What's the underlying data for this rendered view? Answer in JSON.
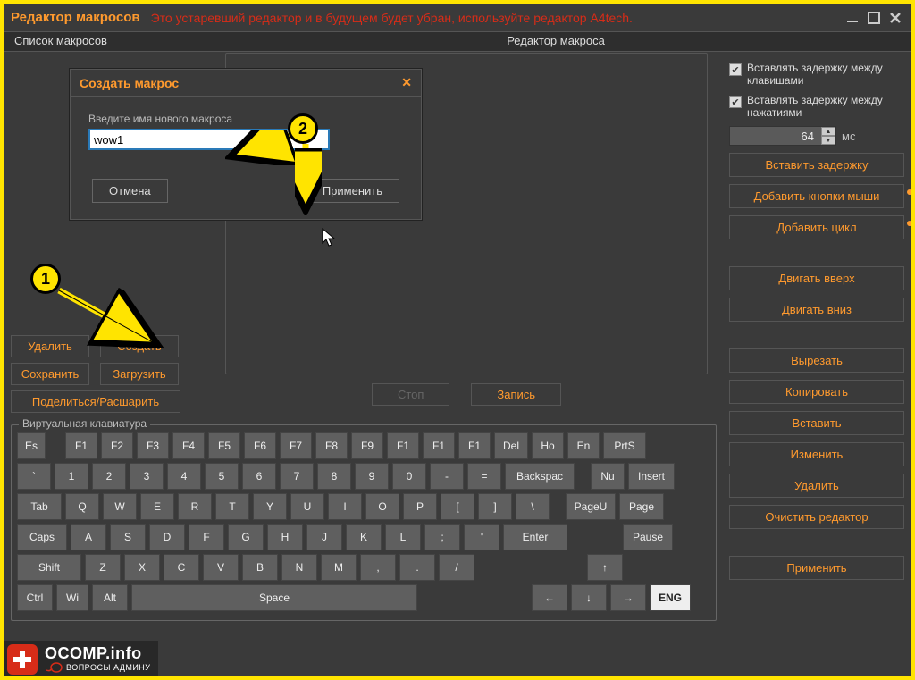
{
  "titlebar": {
    "title": "Редактор макросов",
    "warning": "Это устаревший редактор и в будущем будет убран, используйте редактор A4tech."
  },
  "tabs": {
    "list": "Список макросов",
    "editor": "Редактор макроса"
  },
  "left_buttons": {
    "delete": "Удалить",
    "create": "Создать",
    "save": "Сохранить",
    "load": "Загрузить",
    "share": "Поделиться/Расшарить"
  },
  "record": {
    "stop": "Стоп",
    "record": "Запись"
  },
  "right": {
    "chk1": "Вставлять задержку между клавишами",
    "chk2": "Вставлять задержку между нажатиями",
    "delay_value": "64",
    "delay_unit": "мс",
    "insert_delay": "Вставить задержку",
    "add_mouse": "Добавить кнопки мыши",
    "add_loop": "Добавить цикл",
    "move_up": "Двигать вверх",
    "move_down": "Двигать вниз",
    "cut": "Вырезать",
    "copy": "Копировать",
    "paste": "Вставить",
    "edit": "Изменить",
    "delete": "Удалить",
    "clear": "Очистить редактор",
    "apply": "Применить"
  },
  "vkb": {
    "legend": "Виртуальная клавиатура",
    "row1": [
      "Es",
      "F1",
      "F2",
      "F3",
      "F4",
      "F5",
      "F6",
      "F7",
      "F8",
      "F9",
      "F1",
      "F1",
      "F1",
      "Del",
      "Ho",
      "En",
      "PrtS"
    ],
    "row2": [
      "`",
      "1",
      "2",
      "3",
      "4",
      "5",
      "6",
      "7",
      "8",
      "9",
      "0",
      "-",
      "=",
      "Backspac",
      "Nu",
      "Insert"
    ],
    "row3": [
      "Tab",
      "Q",
      "W",
      "E",
      "R",
      "T",
      "Y",
      "U",
      "I",
      "O",
      "P",
      "[",
      "]",
      "\\",
      "PageU",
      "Page"
    ],
    "row4": [
      "Caps",
      "A",
      "S",
      "D",
      "F",
      "G",
      "H",
      "J",
      "K",
      "L",
      ";",
      "'",
      "Enter",
      "Pause"
    ],
    "row5": [
      "Shift",
      "Z",
      "X",
      "C",
      "V",
      "B",
      "N",
      "M",
      ",",
      ".",
      "/",
      "↑"
    ],
    "row6": [
      "Ctrl",
      "Wi",
      "Alt",
      "Space",
      "←",
      "↓",
      "→",
      "ENG"
    ]
  },
  "dialog": {
    "title": "Создать макрос",
    "label": "Введите имя нового макроса",
    "value": "wow1",
    "cancel": "Отмена",
    "apply": "Применить"
  },
  "badges": {
    "one": "1",
    "two": "2"
  },
  "watermark": {
    "site": "OCOMP.info",
    "tag": "ВОПРОСЫ АДМИНУ"
  }
}
